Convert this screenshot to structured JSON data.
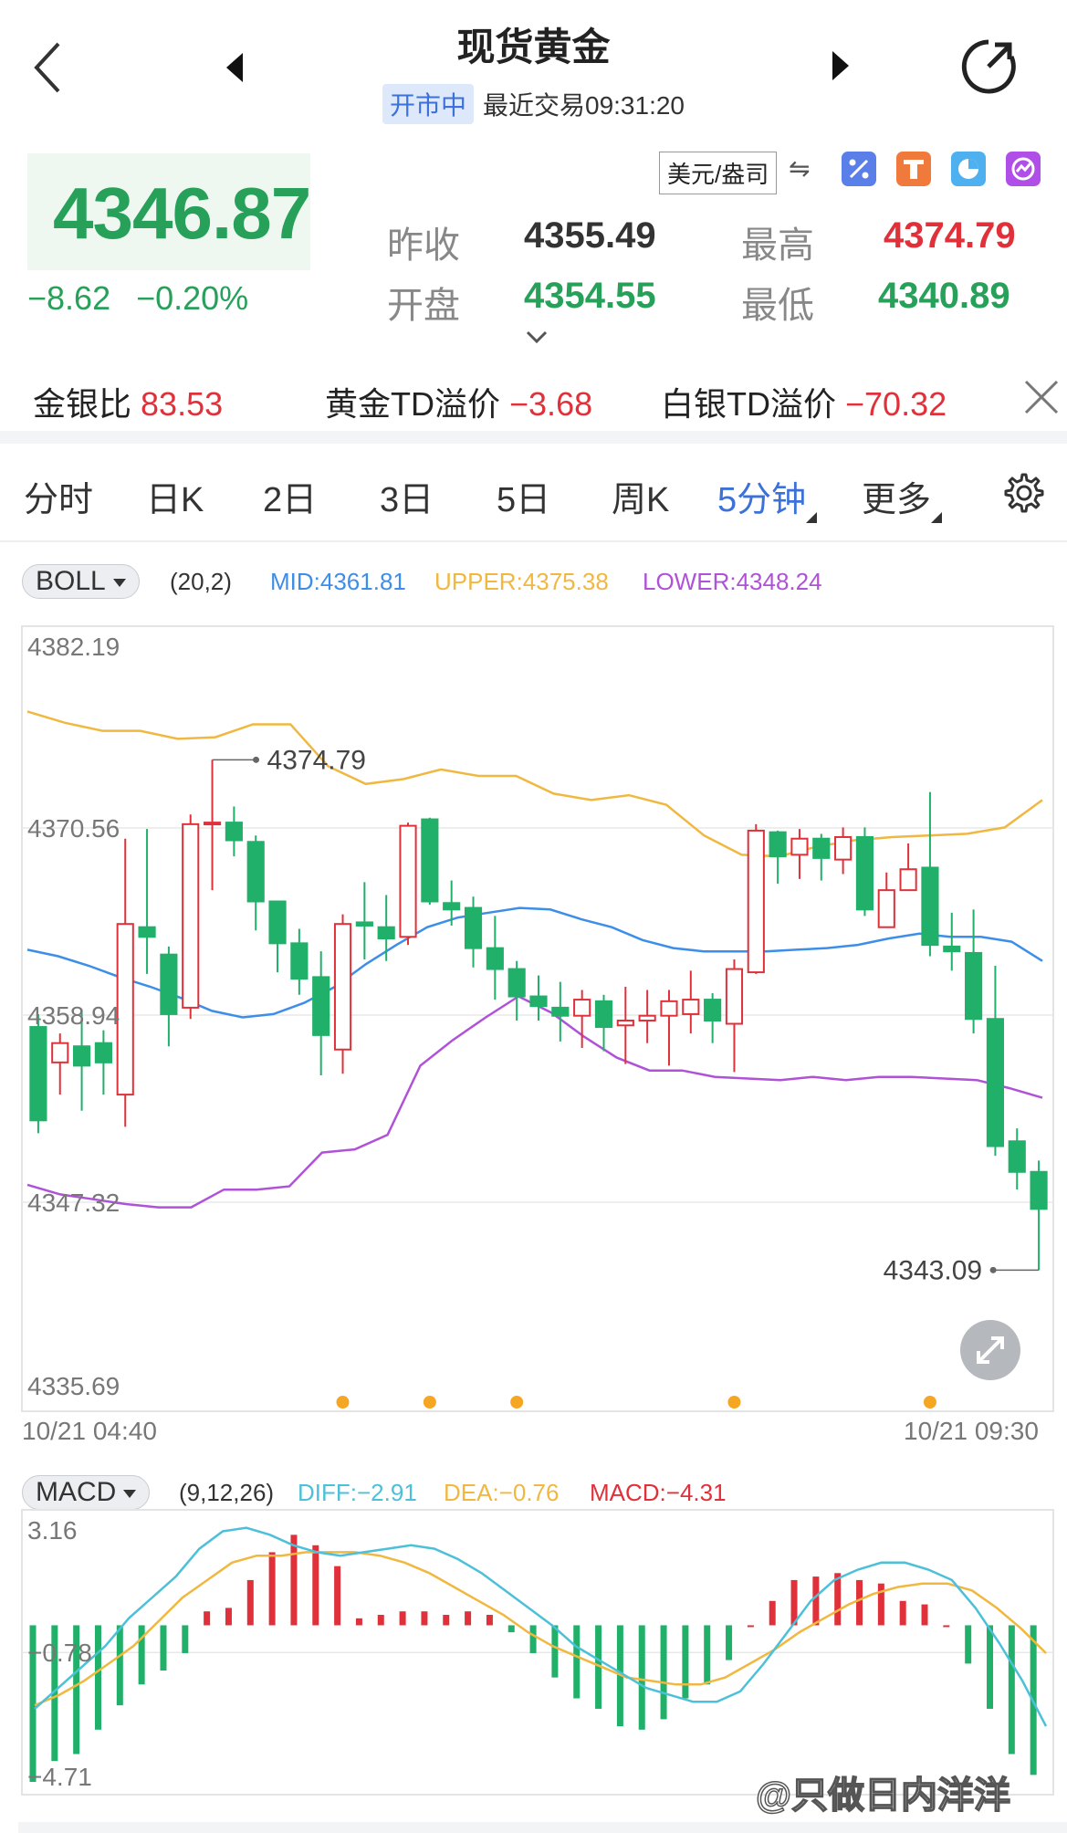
{
  "header": {
    "title": "现货黄金",
    "status_badge": "开市中",
    "trade_time": "最近交易09:31:20"
  },
  "quote": {
    "price": "4346.87",
    "change": "−8.62",
    "change_pct": "−0.20%",
    "unit": "美元/盎司",
    "swap_glyph": "⇋",
    "stats": {
      "prev_close_label": "昨收",
      "prev_close": "4355.49",
      "high_label": "最高",
      "high": "4374.79",
      "open_label": "开盘",
      "open": "4354.55",
      "low_label": "最低",
      "low": "4340.89"
    }
  },
  "ratios": [
    {
      "label": "金银比",
      "value": "83.53"
    },
    {
      "label": "黄金TD溢价",
      "value": "−3.68"
    },
    {
      "label": "白银TD溢价",
      "value": "−70.32"
    }
  ],
  "tabs": [
    {
      "label": "分时"
    },
    {
      "label": "日K"
    },
    {
      "label": "2日"
    },
    {
      "label": "3日"
    },
    {
      "label": "5日"
    },
    {
      "label": "周K"
    },
    {
      "label": "5分钟",
      "active": true,
      "dropdown": true
    },
    {
      "label": "更多",
      "dropdown": true
    }
  ],
  "colors": {
    "up": "#e0313a",
    "down": "#21b06a",
    "mid": "#3d8ee8",
    "upper": "#f0b840",
    "lower": "#b052d8",
    "diff": "#4cc0d8",
    "dea": "#f0b840"
  },
  "boll": {
    "selector": "BOLL",
    "params": "(20,2)",
    "mid": "MID:4361.81",
    "upper": "UPPER:4375.38",
    "lower": "LOWER:4348.24"
  },
  "macd": {
    "selector": "MACD",
    "params": "(9,12,26)",
    "diff": "DIFF:−2.91",
    "dea": "DEA:−0.76",
    "macd": "MACD:−4.31"
  },
  "chart_data": [
    {
      "type": "candlestick",
      "y_ticks": [
        "4382.19",
        "4370.56",
        "4358.94",
        "4347.32",
        "4335.69"
      ],
      "ylim": [
        4335.69,
        4382.19
      ],
      "x_start_label": "10/21 04:40",
      "x_end_label": "10/21 09:30",
      "high_marker": "4374.79",
      "low_marker": "4343.09",
      "candles": [
        [
          4358.2,
          4352.4,
          4359.0,
          4351.6
        ],
        [
          4356.0,
          4357.2,
          4357.8,
          4354.0
        ],
        [
          4357.0,
          4355.8,
          4359.2,
          4353.0
        ],
        [
          4357.2,
          4356.0,
          4358.0,
          4354.0
        ],
        [
          4354.0,
          4364.6,
          4369.9,
          4352.0
        ],
        [
          4364.4,
          4363.8,
          4370.5,
          4361.5
        ],
        [
          4362.7,
          4359.0,
          4363.2,
          4357.0
        ],
        [
          4359.4,
          4370.8,
          4371.4,
          4358.7
        ],
        [
          4370.9,
          4370.9,
          4374.8,
          4366.7
        ],
        [
          4370.9,
          4369.8,
          4371.9,
          4368.8
        ],
        [
          4369.7,
          4366.0,
          4370.1,
          4364.2
        ],
        [
          4366.0,
          4363.4,
          4366.0,
          4361.6
        ],
        [
          4363.4,
          4361.2,
          4364.3,
          4360.2
        ],
        [
          4361.3,
          4357.7,
          4362.9,
          4355.2
        ],
        [
          4356.8,
          4364.6,
          4365.2,
          4355.3
        ],
        [
          4364.7,
          4364.5,
          4367.2,
          4362.4
        ],
        [
          4364.4,
          4363.7,
          4366.4,
          4362.3
        ],
        [
          4363.8,
          4370.7,
          4370.9,
          4363.3
        ],
        [
          4371.1,
          4366.0,
          4371.2,
          4365.8
        ],
        [
          4365.9,
          4365.5,
          4367.3,
          4364.5
        ],
        [
          4365.6,
          4363.1,
          4366.3,
          4361.9
        ],
        [
          4363.1,
          4361.8,
          4365.1,
          4359.9
        ],
        [
          4361.8,
          4360.1,
          4362.3,
          4358.6
        ],
        [
          4360.1,
          4359.5,
          4361.4,
          4358.6
        ],
        [
          4359.4,
          4358.9,
          4361.0,
          4357.3
        ],
        [
          4358.9,
          4359.9,
          4360.5,
          4356.9
        ],
        [
          4359.8,
          4358.2,
          4360.2,
          4356.7
        ],
        [
          4358.3,
          4358.6,
          4360.7,
          4355.9
        ],
        [
          4358.6,
          4358.9,
          4360.5,
          4357.2
        ],
        [
          4358.9,
          4359.8,
          4360.5,
          4355.8
        ],
        [
          4359.0,
          4359.9,
          4361.7,
          4357.8
        ],
        [
          4359.9,
          4358.6,
          4360.3,
          4357.2
        ],
        [
          4358.4,
          4361.8,
          4362.4,
          4355.4
        ],
        [
          4361.6,
          4370.4,
          4370.8,
          4361.5
        ],
        [
          4370.3,
          4368.8,
          4370.4,
          4367.1
        ],
        [
          4368.9,
          4369.9,
          4370.5,
          4367.4
        ],
        [
          4369.9,
          4368.7,
          4370.2,
          4367.3
        ],
        [
          4368.6,
          4370.0,
          4370.6,
          4367.7
        ],
        [
          4370.0,
          4365.5,
          4370.6,
          4365.1
        ],
        [
          4364.4,
          4366.7,
          4367.8,
          4364.6
        ],
        [
          4366.7,
          4368.0,
          4369.6,
          4366.7
        ],
        [
          4368.1,
          4363.3,
          4372.8,
          4362.6
        ],
        [
          4363.2,
          4362.9,
          4365.3,
          4361.7
        ],
        [
          4362.8,
          4358.7,
          4365.5,
          4357.8
        ],
        [
          4358.7,
          4350.8,
          4362.0,
          4350.2
        ],
        [
          4351.1,
          4349.2,
          4351.9,
          4348.1
        ],
        [
          4349.2,
          4346.9,
          4349.9,
          4343.1
        ]
      ],
      "mid": [
        4363.0,
        4362.6,
        4362.0,
        4361.3,
        4360.7,
        4360.0,
        4359.2,
        4358.8,
        4359.0,
        4359.7,
        4360.7,
        4362.1,
        4363.3,
        4364.4,
        4365.0,
        4365.3,
        4365.6,
        4365.5,
        4364.9,
        4364.4,
        4363.6,
        4363.1,
        4362.9,
        4362.9,
        4362.9,
        4363.0,
        4363.1,
        4363.3,
        4363.7,
        4364.0,
        4363.8,
        4363.8,
        4363.5,
        4362.3
      ],
      "upper": [
        4377.8,
        4377.1,
        4376.6,
        4376.6,
        4376.1,
        4376.2,
        4377.0,
        4377.0,
        4374.4,
        4373.3,
        4373.6,
        4374.2,
        4373.8,
        4373.8,
        4372.7,
        4372.3,
        4372.6,
        4372.0,
        4370.1,
        4368.9,
        4368.8,
        4369.4,
        4369.8,
        4370.0,
        4370.1,
        4370.2,
        4370.6,
        4372.3
      ],
      "lower": [
        4348.4,
        4347.8,
        4347.5,
        4347.2,
        4347.0,
        4347.0,
        4348.1,
        4348.1,
        4348.3,
        4350.4,
        4350.6,
        4351.5,
        4355.8,
        4357.4,
        4358.8,
        4360.1,
        4359.1,
        4357.6,
        4356.3,
        4355.5,
        4355.5,
        4355.1,
        4355.0,
        4354.9,
        4355.1,
        4354.9,
        4355.1,
        4355.1,
        4355.0,
        4354.9,
        4354.4,
        4353.8
      ],
      "event_dots_x_index": [
        14,
        18,
        22,
        32,
        41
      ]
    },
    {
      "type": "bar",
      "title": "MACD",
      "y_ticks": [
        "3.16",
        "−0.78",
        "−4.71"
      ],
      "ylim": [
        -4.71,
        3.16
      ],
      "histogram": [
        -4.5,
        -3.9,
        -3.7,
        -3.0,
        -2.3,
        -1.7,
        -1.3,
        -0.8,
        0.4,
        0.5,
        1.3,
        2.1,
        2.6,
        2.3,
        1.7,
        0.2,
        0.3,
        0.4,
        0.4,
        0.3,
        0.4,
        0.3,
        -0.2,
        -0.8,
        -1.5,
        -2.1,
        -2.4,
        -2.9,
        -3.0,
        -2.7,
        -2.1,
        -1.7,
        -1.0,
        0.0,
        0.7,
        1.3,
        1.4,
        1.5,
        1.3,
        1.2,
        0.7,
        0.6,
        0.0,
        -1.1,
        -2.4,
        -3.7,
        -4.3
      ],
      "diff": [
        -2.4,
        -1.8,
        -1.2,
        -0.6,
        0.2,
        0.8,
        1.4,
        2.2,
        2.7,
        2.8,
        2.6,
        2.3,
        2.1,
        2.0,
        2.1,
        2.2,
        2.3,
        2.2,
        1.9,
        1.5,
        1.0,
        0.5,
        0.0,
        -0.6,
        -1.0,
        -1.4,
        -1.8,
        -2.0,
        -2.2,
        -2.2,
        -1.9,
        -1.1,
        -0.2,
        0.7,
        1.3,
        1.6,
        1.8,
        1.8,
        1.6,
        1.3,
        0.5,
        -0.5,
        -1.6,
        -2.9
      ],
      "dea": [
        -2.3,
        -2.0,
        -1.6,
        -1.1,
        -0.6,
        0.1,
        0.8,
        1.3,
        1.8,
        2.0,
        2.0,
        2.1,
        2.1,
        2.1,
        2.0,
        1.8,
        1.5,
        1.1,
        0.7,
        0.3,
        -0.2,
        -0.6,
        -0.9,
        -1.2,
        -1.5,
        -1.6,
        -1.7,
        -1.7,
        -1.5,
        -1.1,
        -0.7,
        -0.2,
        0.2,
        0.6,
        0.9,
        1.1,
        1.2,
        1.2,
        1.0,
        0.5,
        -0.1,
        -0.8
      ]
    }
  ],
  "watermark": "@只做日内洋洋"
}
